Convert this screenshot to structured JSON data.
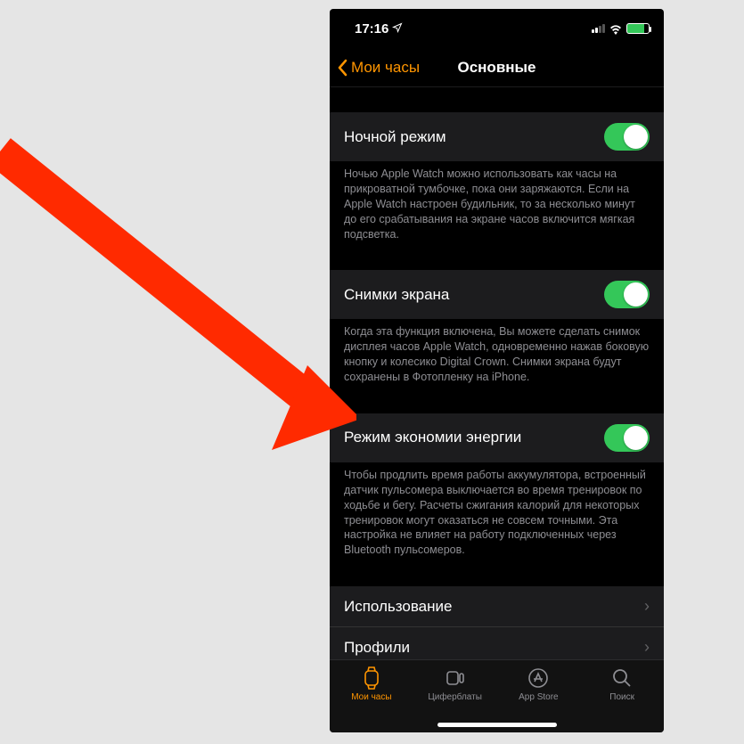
{
  "status": {
    "time": "17:16"
  },
  "nav": {
    "back": "Мои часы",
    "title": "Основные"
  },
  "settings": {
    "night": {
      "label": "Ночной режим",
      "desc": "Ночью Apple Watch можно использовать как часы на прикроватной тумбочке, пока они заряжаются. Если на Apple Watch настроен будильник, то за несколько минут до его срабатывания на экране часов включится мягкая подсветка."
    },
    "screenshots": {
      "label": "Снимки экрана",
      "desc": "Когда эта функция включена, Вы можете сделать снимок дисплея часов Apple Watch, одновременно нажав боковую кнопку и колесико Digital Crown. Снимки экрана будут сохранены в Фотопленку на iPhone."
    },
    "power": {
      "label": "Режим экономии энергии",
      "desc": "Чтобы продлить время работы аккумулятора, встроенный датчик пульсомера выключается во время тренировок по ходьбе и бегу. Расчеты сжигания калорий для некоторых тренировок могут оказаться не совсем точными. Эта настройка не влияет на работу подключенных через Bluetooth пульсомеров."
    },
    "usage": {
      "label": "Использование"
    },
    "profiles": {
      "label": "Профили"
    }
  },
  "tabs": {
    "watch": "Мои часы",
    "faces": "Циферблаты",
    "appstore": "App Store",
    "search": "Поиск"
  }
}
